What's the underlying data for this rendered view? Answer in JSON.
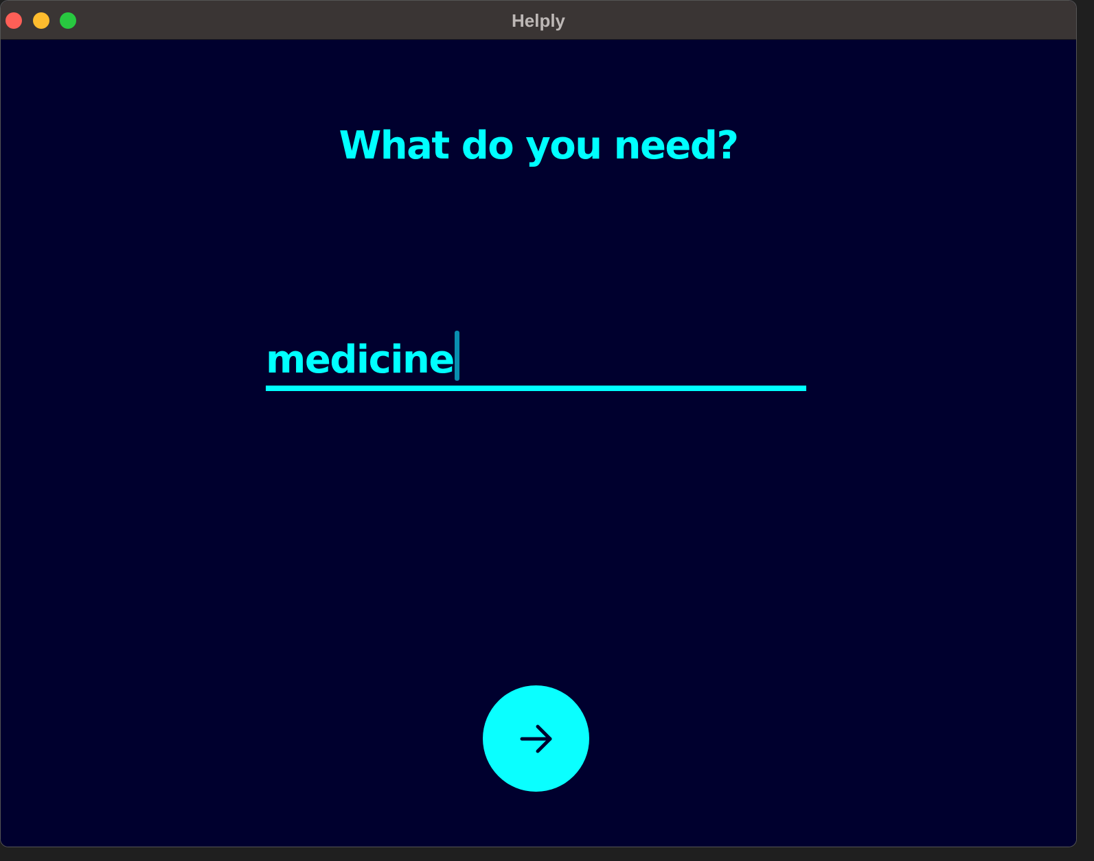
{
  "window": {
    "title": "Helply"
  },
  "main": {
    "heading": "What do you need?",
    "search": {
      "value": "medicine"
    },
    "next_button": {
      "icon": "arrow-right-icon"
    }
  },
  "colors": {
    "background": "#00002e",
    "accent": "#00ffff",
    "titlebar": "#3a3534"
  }
}
